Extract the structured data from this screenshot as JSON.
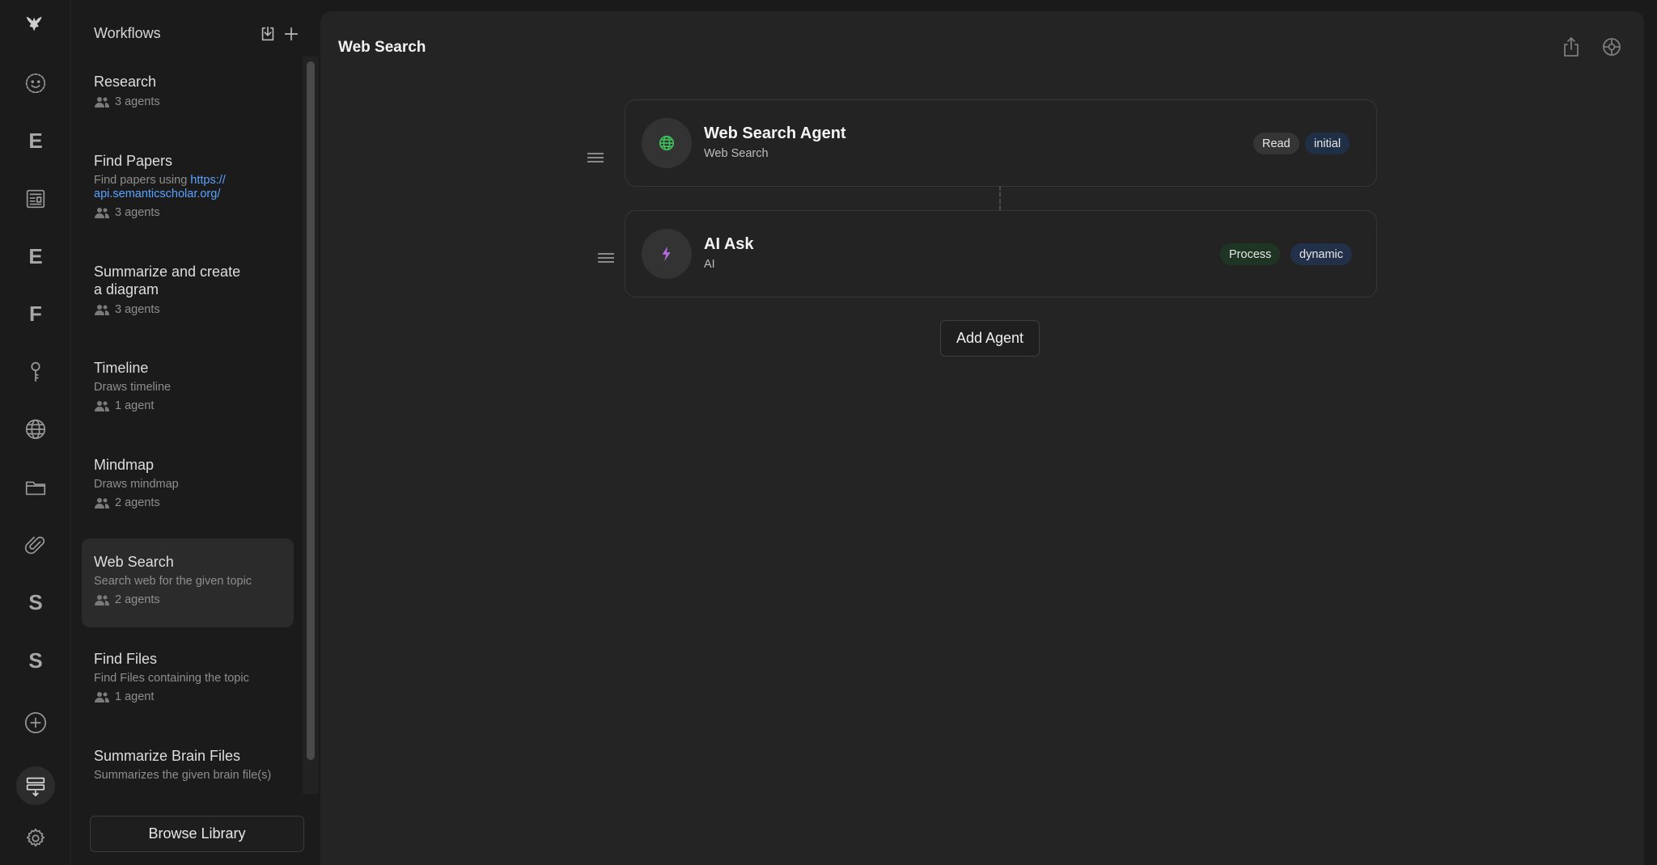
{
  "rail": {
    "items": [
      {
        "type": "icon",
        "icon": "logo-icon"
      },
      {
        "type": "icon",
        "icon": "smiley-icon"
      },
      {
        "type": "letter",
        "label": "E"
      },
      {
        "type": "icon",
        "icon": "newspaper-icon"
      },
      {
        "type": "letter",
        "label": "E"
      },
      {
        "type": "letter",
        "label": "F"
      },
      {
        "type": "icon",
        "icon": "key-icon"
      },
      {
        "type": "icon",
        "icon": "globe-icon"
      },
      {
        "type": "icon",
        "icon": "folder-icon"
      },
      {
        "type": "icon",
        "icon": "paperclip-icon"
      },
      {
        "type": "letter",
        "label": "S"
      },
      {
        "type": "letter",
        "label": "S"
      },
      {
        "type": "icon",
        "icon": "add-circle-icon"
      },
      {
        "type": "icon",
        "icon": "workflows-icon",
        "active": true
      },
      {
        "type": "icon",
        "icon": "gear-icon"
      }
    ]
  },
  "panel": {
    "title": "Workflows",
    "import_icon": "import-icon",
    "add_icon": "plus-icon",
    "workflows": [
      {
        "title": "Research",
        "agents": "3 agents"
      },
      {
        "title": "Find Papers",
        "desc_prefix": "Find papers using ",
        "desc_link_1": "https://",
        "desc_link_2": "api.semanticscholar.org/",
        "agents": "3 agents"
      },
      {
        "title_1": "Summarize and create",
        "title_2": "a diagram",
        "agents": "3 agents"
      },
      {
        "title": "Timeline",
        "desc": "Draws timeline",
        "agents": "1 agent"
      },
      {
        "title": "Mindmap",
        "desc": "Draws mindmap",
        "agents": "2 agents"
      },
      {
        "title": "Web Search",
        "desc": "Search web for the given topic",
        "agents": "2 agents",
        "active": true
      },
      {
        "title": "Find Files",
        "desc": "Find Files containing the topic",
        "agents": "1 agent"
      },
      {
        "title": "Summarize Brain Files",
        "desc": "Summarizes the given brain file(s)"
      }
    ],
    "browse_label": "Browse Library"
  },
  "main": {
    "title": "Web Search",
    "share_icon": "share-icon",
    "settings_icon": "settings-icon",
    "agents": [
      {
        "name": "Web Search Agent",
        "sub": "Web Search",
        "icon": "globe-icon",
        "icon_color": "#3fbf5a",
        "chips": [
          "Read",
          "initial"
        ]
      },
      {
        "name": "AI Ask",
        "sub": "AI",
        "icon": "bolt-icon",
        "icon_color": "#b46be0",
        "chips": [
          "Process",
          "dynamic"
        ]
      }
    ],
    "add_agent_label": "Add Agent"
  }
}
